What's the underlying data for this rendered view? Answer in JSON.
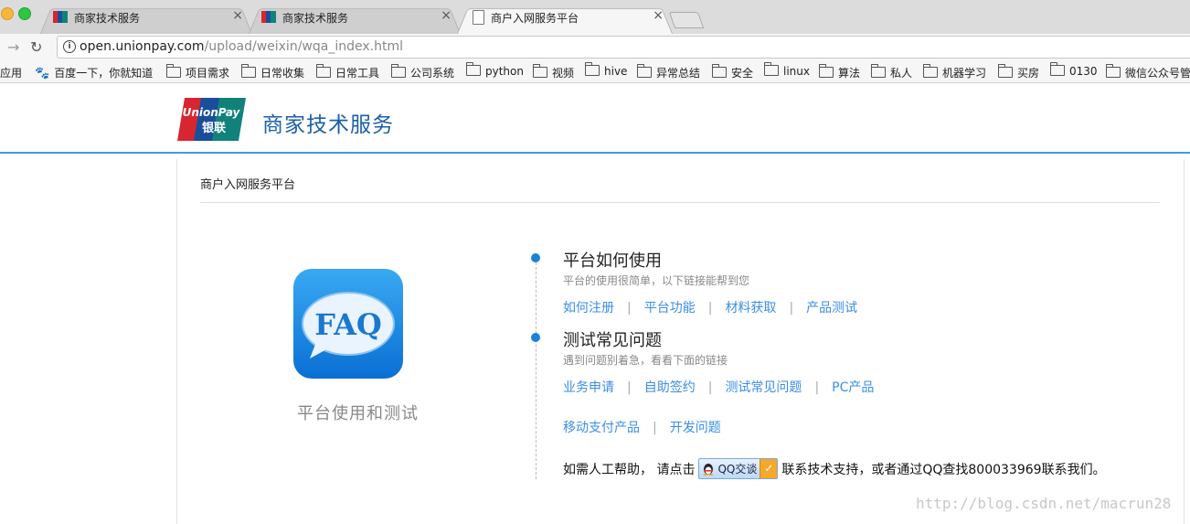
{
  "browser": {
    "tabs": [
      {
        "title": "商家技术服务",
        "close": "×"
      },
      {
        "title": "商家技术服务",
        "close": "×"
      },
      {
        "title": "商户入网服务平台",
        "close": "×"
      }
    ],
    "url_host": "open.unionpay.com",
    "url_path": "/upload/weixin/wqa_index.html",
    "bookmarks": [
      "应用",
      "百度一下，你就知道",
      "项目需求",
      "日常收集",
      "日常工具",
      "公司系统",
      "python",
      "视频",
      "hive",
      "异常总结",
      "安全",
      "linux",
      "算法",
      "私人",
      "机器学习",
      "买房",
      "0130",
      "微信公众号管"
    ]
  },
  "header": {
    "logo_text_top": "UnionPay",
    "logo_text_bottom": "银联",
    "brand": "商家技术服务"
  },
  "panel": {
    "title": "商户入网服务平台",
    "faq_label": "FAQ",
    "faq_caption": "平台使用和测试",
    "sections": [
      {
        "title": "平台如何使用",
        "subtitle": "平台的使用很简单，以下链接能帮到您",
        "links": [
          "如何注册",
          "平台功能",
          "材料获取",
          "产品测试"
        ]
      },
      {
        "title": "测试常见问题",
        "subtitle": "遇到问题别着急，看看下面的链接",
        "links": [
          "业务申请",
          "自助签约",
          "测试常见问题",
          "PC产品"
        ],
        "links2": [
          "移动支付产品",
          "开发问题"
        ]
      }
    ],
    "separator": "|",
    "help_prefix": "如需人工帮助， 请点击",
    "qq_button": "QQ交谈",
    "help_suffix": "联系技术支持，或者通过QQ查找800033969联系我们。"
  },
  "watermark": "http://blog.csdn.net/macrun28",
  "colors": {
    "brand_blue": "#1b5fa8",
    "link_blue": "#3a8ee6",
    "accent_line": "#3d9ae8",
    "dot": "#1a82d8"
  }
}
